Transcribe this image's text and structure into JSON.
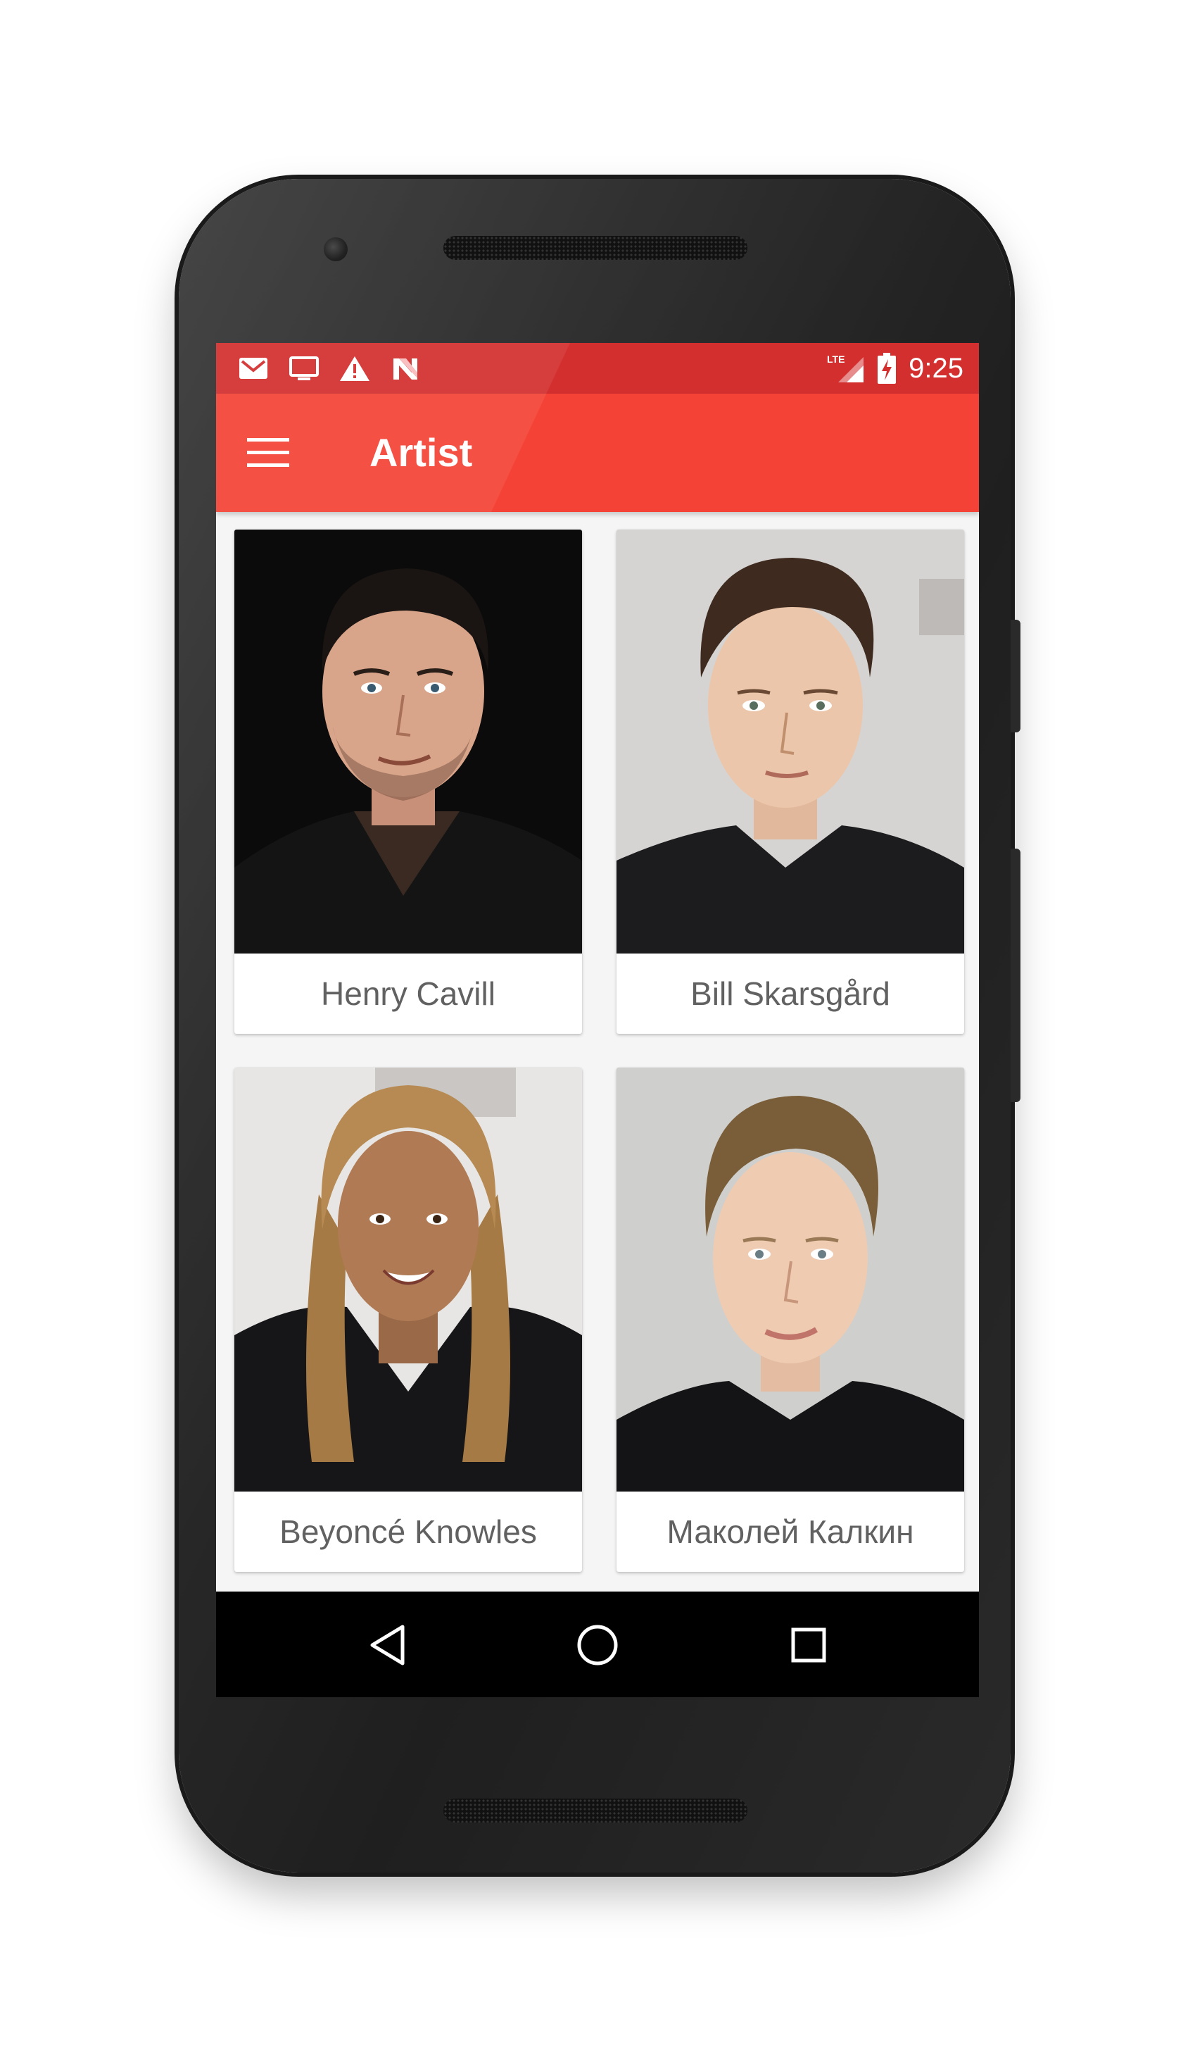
{
  "status_bar": {
    "time": "9:25",
    "network": "LTE",
    "left_icons": [
      "gmail-icon",
      "cast-screen-icon",
      "warning-icon",
      "n-app-icon"
    ],
    "right_icons": [
      "lte-signal-icon",
      "battery-charging-icon"
    ],
    "color": "#d32f2f"
  },
  "app_bar": {
    "title": "Artist",
    "menu_icon": "hamburger-menu-icon",
    "color": "#f44336"
  },
  "artists": [
    {
      "name": "Henry Cavill",
      "photo": "portrait-photo"
    },
    {
      "name": "Bill Skarsgård",
      "photo": "portrait-photo"
    },
    {
      "name": "Beyoncé Knowles",
      "photo": "portrait-photo"
    },
    {
      "name": "Маколей Калкин",
      "photo": "portrait-photo"
    }
  ],
  "nav_bar": {
    "buttons": [
      "back-triangle-icon",
      "home-circle-icon",
      "recents-square-icon"
    ]
  }
}
